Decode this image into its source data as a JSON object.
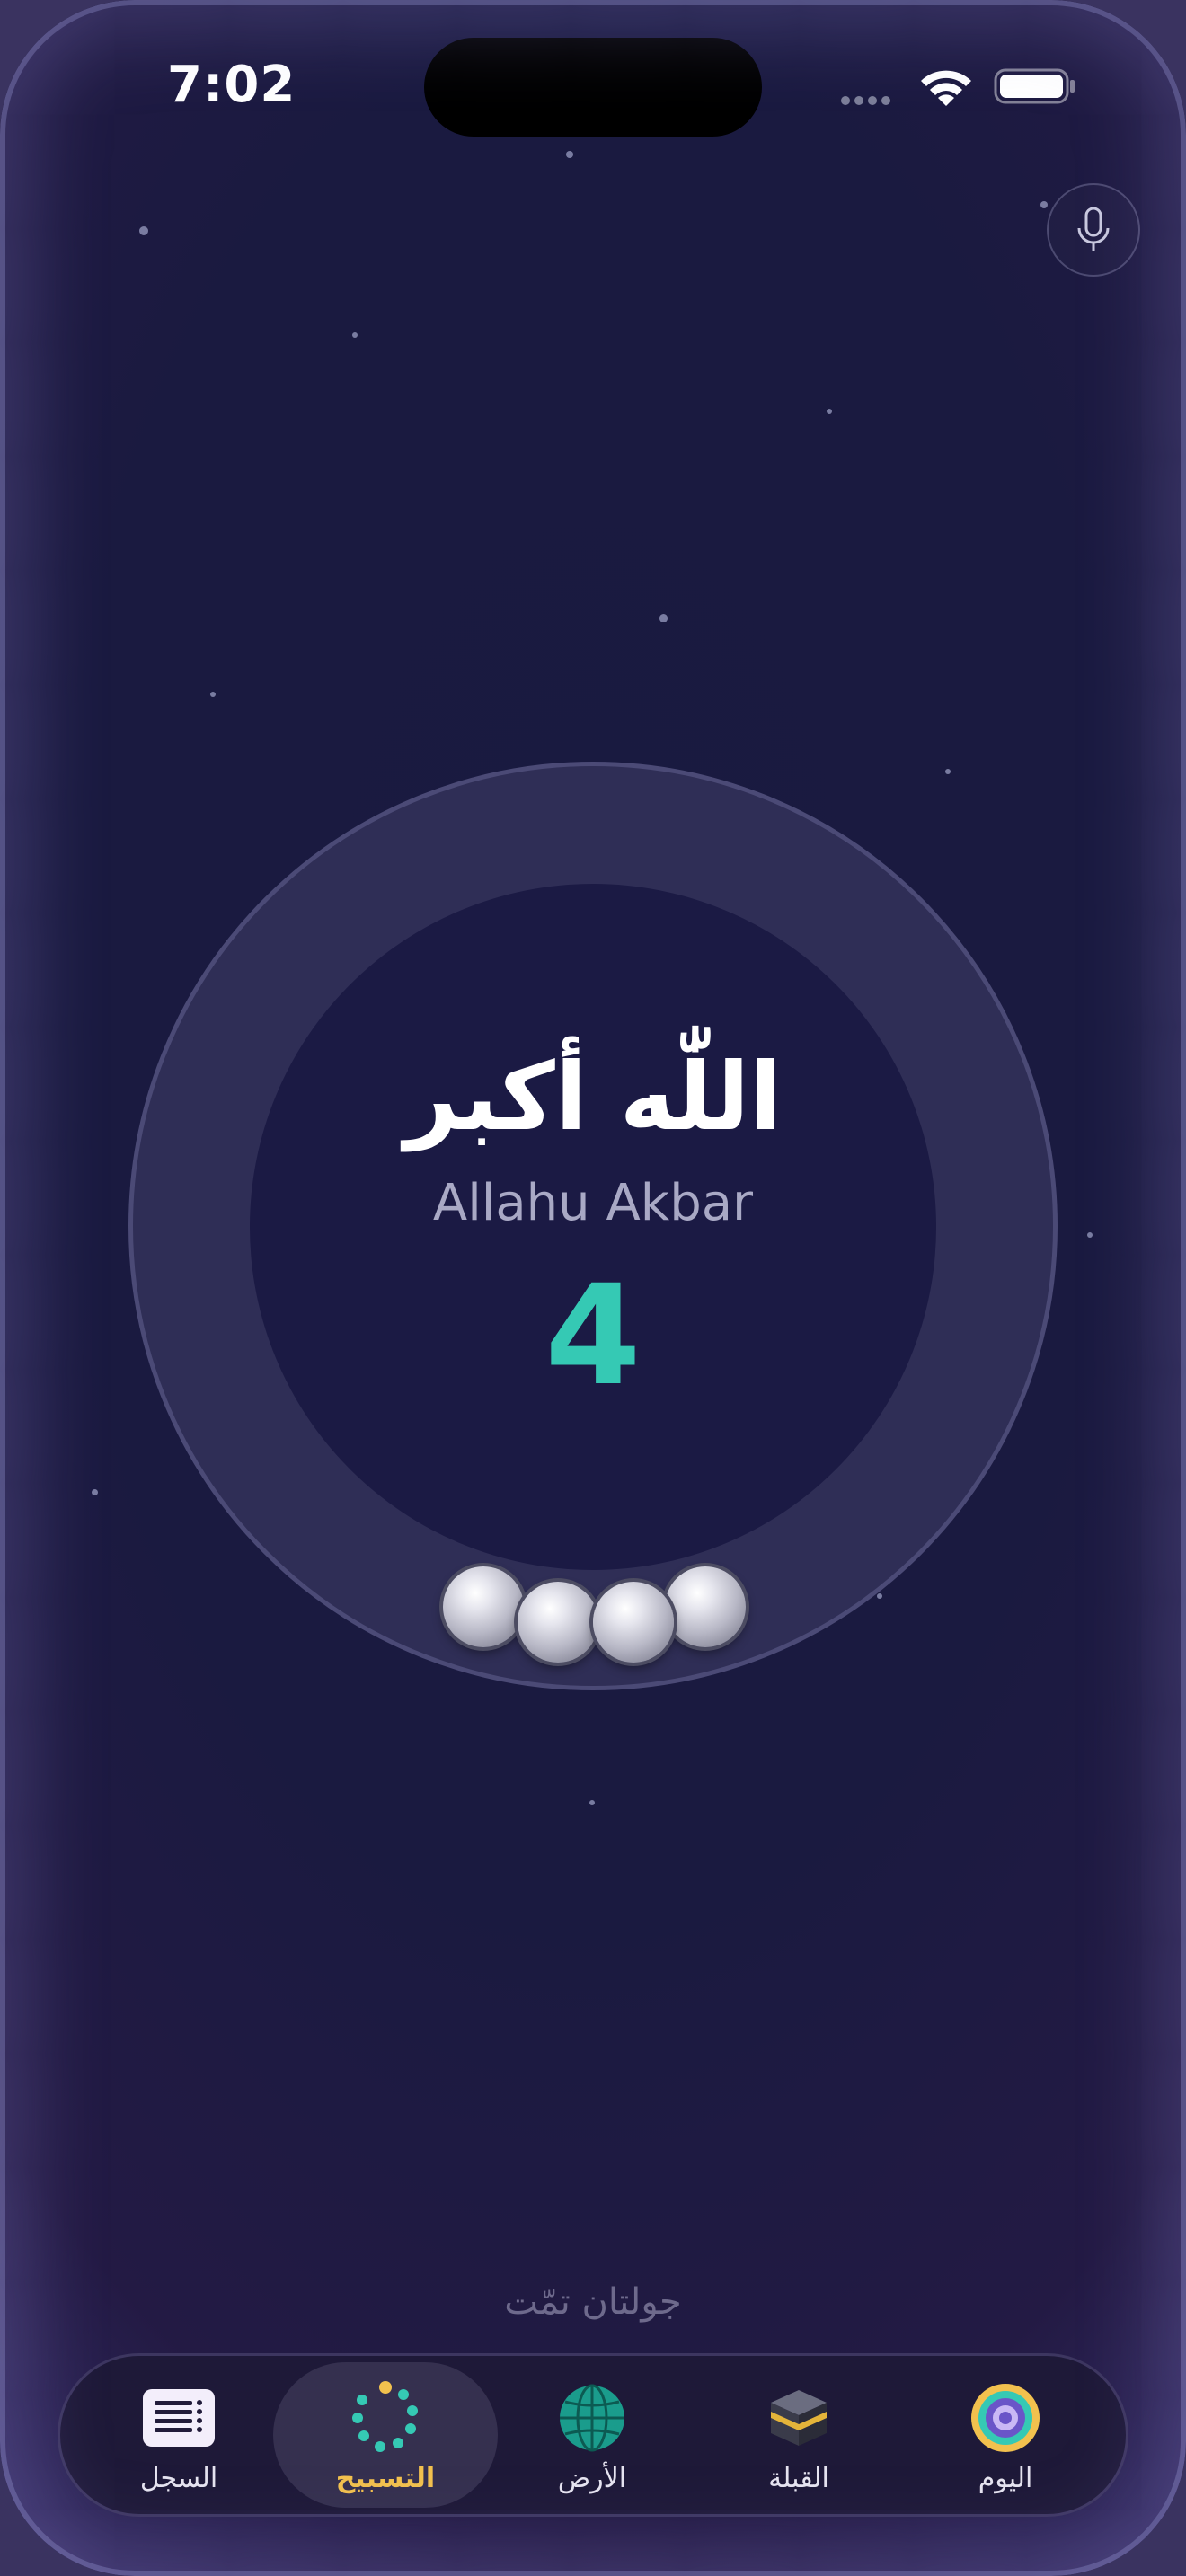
{
  "status_bar": {
    "time": "7:02"
  },
  "header": {
    "mic_icon": "microphone-icon"
  },
  "dhikr": {
    "arabic": "اللّٰه أكبر",
    "transliteration": "Allahu Akbar",
    "count": "4"
  },
  "beads": {
    "count": 4
  },
  "rounds": {
    "completed_text": "جولتان تمّت"
  },
  "tabbar": {
    "active_color": "#f2c14e",
    "items": [
      {
        "label": "السجل",
        "icon": "log-list-icon"
      },
      {
        "label": "التسبيح",
        "icon": "tasbih-beads-icon"
      },
      {
        "label": "الأرض",
        "icon": "globe-icon"
      },
      {
        "label": "القبلة",
        "icon": "kaaba-icon"
      },
      {
        "label": "اليوم",
        "icon": "today-target-icon"
      }
    ]
  },
  "colors": {
    "accent_teal": "#35c9b4",
    "background": "#1a1a40",
    "tab_active_label": "#f2c14e"
  }
}
